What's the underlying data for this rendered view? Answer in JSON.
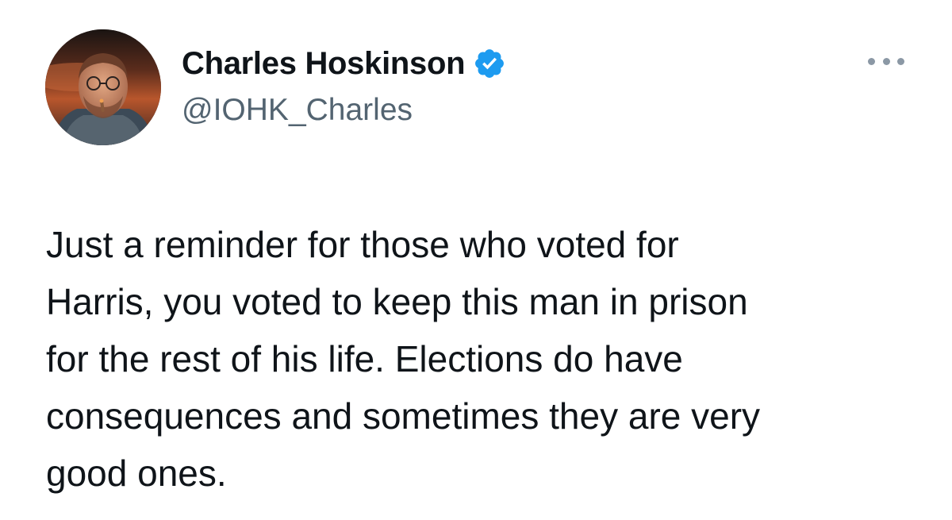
{
  "author": {
    "display_name": "Charles Hoskinson",
    "handle": "@IOHK_Charles",
    "verified": true,
    "avatar_icon": "profile-photo-astronaut"
  },
  "tweet": {
    "text": "Just a reminder for those who voted for\nHarris, you voted to keep this man in prison\nfor the rest of his life. Elections do have\nconsequences and sometimes they are very\ngood ones."
  },
  "icons": {
    "verified": "verified-badge-icon",
    "more": "more-options-icon"
  },
  "colors": {
    "verified_badge": "#1d9bf0",
    "handle_text": "#536471",
    "more_dots": "#8b98a5",
    "body_text": "#0f1419"
  }
}
